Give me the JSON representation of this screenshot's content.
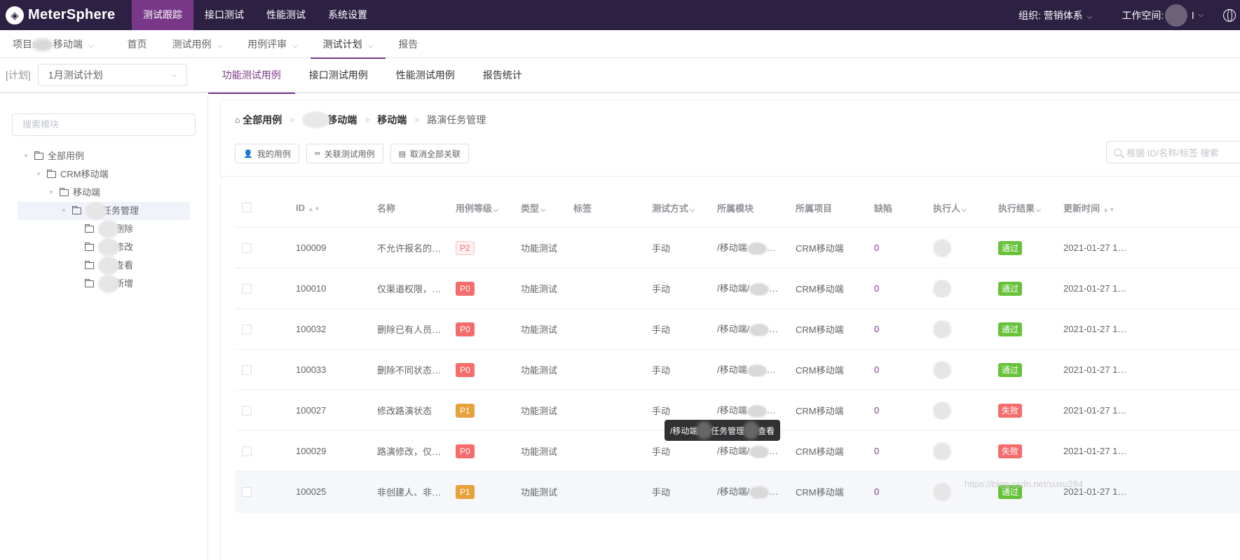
{
  "app": {
    "logo_text": "MeterSphere"
  },
  "topnav": {
    "items": [
      "测试跟踪",
      "接口测试",
      "性能测试",
      "系统设置"
    ],
    "org_label": "组织: 营销体系",
    "workspace_label": "工作空间:",
    "workspace_suffix": "l"
  },
  "subnav": {
    "project_prefix": "项目:",
    "project_name": "移动端",
    "items": [
      "首页",
      "测试用例",
      "用例评审",
      "测试计划",
      "报告"
    ]
  },
  "plan": {
    "label": "[计划]",
    "selected": "1月测试计划",
    "tabs": [
      "功能测试用例",
      "接口测试用例",
      "性能测试用例",
      "报告统计"
    ]
  },
  "tree": {
    "search_placeholder": "搜索模块",
    "nodes": {
      "all": "全部用例",
      "crm": "CRM移动端",
      "mobile": "移动端",
      "road": "任务管理",
      "del": "删除",
      "edit": "修改",
      "view": "查看",
      "add": "新增"
    }
  },
  "breadcrumb": {
    "all": "全部用例",
    "crm_suffix": "移动端",
    "mobile": "移动端",
    "road": "路演任务管理"
  },
  "actions": {
    "my_cases": "我的用例",
    "link_cases": "关联测试用例",
    "unlink_all": "取消全部关联",
    "search_placeholder": "根据 ID/名称/标签 搜索"
  },
  "table": {
    "headers": {
      "id": "ID",
      "name": "名称",
      "level": "用例等级",
      "type": "类型",
      "tag": "标签",
      "method": "测试方式",
      "module": "所属模块",
      "project": "所属项目",
      "bug": "缺陷",
      "executor": "执行人",
      "result": "执行结果",
      "updated": "更新时间"
    },
    "rows": [
      {
        "id": "100009",
        "name": "不允许报名的…",
        "level": "P2",
        "type": "功能测试",
        "method": "手动",
        "module": "/移动端",
        "project": "CRM移动端",
        "bug": "0",
        "result": "通过",
        "updated": "2021-01-27 1…"
      },
      {
        "id": "100010",
        "name": "仅渠道权限，…",
        "level": "P0",
        "type": "功能测试",
        "method": "手动",
        "module": "/移动端/",
        "project": "CRM移动端",
        "bug": "0",
        "result": "通过",
        "updated": "2021-01-27 1…"
      },
      {
        "id": "100032",
        "name": "删除已有人员…",
        "level": "P0",
        "type": "功能测试",
        "method": "手动",
        "module": "/移动端/",
        "project": "CRM移动端",
        "bug": "0",
        "result": "通过",
        "updated": "2021-01-27 1…"
      },
      {
        "id": "100033",
        "name": "删除不同状态…",
        "level": "P0",
        "type": "功能测试",
        "method": "手动",
        "module": "/移动端",
        "project": "CRM移动端",
        "bug": "0",
        "result": "通过",
        "updated": "2021-01-27 1…"
      },
      {
        "id": "100027",
        "name": "修改路演状态",
        "level": "P1",
        "type": "功能测试",
        "method": "手动",
        "module": "/移动端",
        "project": "CRM移动端",
        "bug": "0",
        "result": "失败",
        "updated": "2021-01-27 1…"
      },
      {
        "id": "100029",
        "name": "路演修改，仅…",
        "level": "P0",
        "type": "功能测试",
        "method": "手动",
        "module": "/移动端/",
        "project": "CRM移动端",
        "bug": "0",
        "result": "失败",
        "updated": "2021-01-27 1…"
      },
      {
        "id": "100025",
        "name": "非创建人、非…",
        "level": "P1",
        "type": "功能测试",
        "method": "手动",
        "module": "/移动端/",
        "project": "CRM移动端",
        "bug": "0",
        "result": "通过",
        "updated": "2021-01-27 1…"
      }
    ]
  },
  "tooltip": {
    "part1": "/移动端",
    "part2": "任务管理",
    "part3": "查看"
  },
  "watermark": "https://blog.csdn.net/suxu284"
}
